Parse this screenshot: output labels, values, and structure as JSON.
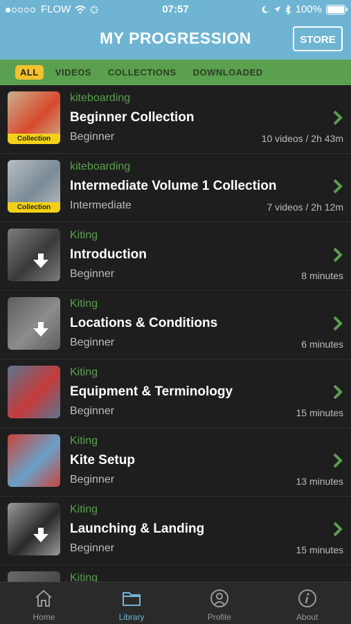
{
  "status_bar": {
    "carrier": "FLOW",
    "time": "07:57",
    "battery": "100%"
  },
  "header": {
    "title": "MY PROGRESSION",
    "store_label": "STORE"
  },
  "filters": [
    {
      "label": "ALL",
      "active": true
    },
    {
      "label": "VIDEOS",
      "active": false
    },
    {
      "label": "COLLECTIONS",
      "active": false
    },
    {
      "label": "DOWNLOADED",
      "active": false
    }
  ],
  "items": [
    {
      "category": "kiteboarding",
      "title": "Beginner Collection",
      "level": "Beginner",
      "meta": "10 videos / 2h 43m",
      "badge": "Collection",
      "thumb_color": "#c9b08c",
      "accent": "#d84a2f",
      "download": false
    },
    {
      "category": "kiteboarding",
      "title": "Intermediate Volume 1 Collection",
      "level": "Intermediate",
      "meta": "7 videos / 2h 12m",
      "badge": "Collection",
      "thumb_color": "#b9bec2",
      "accent": "#7a8a96",
      "download": false
    },
    {
      "category": "Kiting",
      "title": "Introduction",
      "level": "Beginner",
      "meta": "8 minutes",
      "badge": "",
      "thumb_color": "#7c7c7c",
      "accent": "#3a3a3a",
      "download": true
    },
    {
      "category": "Kiting",
      "title": "Locations & Conditions",
      "level": "Beginner",
      "meta": "6 minutes",
      "badge": "",
      "thumb_color": "#5e5e5e",
      "accent": "#8c8c8c",
      "download": true
    },
    {
      "category": "Kiting",
      "title": "Equipment & Terminology",
      "level": "Beginner",
      "meta": "15 minutes",
      "badge": "",
      "thumb_color": "#5c7490",
      "accent": "#c43b3b",
      "download": false
    },
    {
      "category": "Kiting",
      "title": "Kite Setup",
      "level": "Beginner",
      "meta": "13 minutes",
      "badge": "",
      "thumb_color": "#c9453a",
      "accent": "#6aa0c8",
      "download": false
    },
    {
      "category": "Kiting",
      "title": "Launching & Landing",
      "level": "Beginner",
      "meta": "15 minutes",
      "badge": "",
      "thumb_color": "#9a9a9a",
      "accent": "#2a2a2a",
      "download": true
    },
    {
      "category": "Kiting",
      "title": "",
      "level": "",
      "meta": "",
      "badge": "",
      "thumb_color": "#6a6a6a",
      "accent": "#4a4a4a",
      "download": false
    }
  ],
  "tabs": [
    {
      "label": "Home",
      "icon": "home-icon",
      "active": false
    },
    {
      "label": "Library",
      "icon": "folder-icon",
      "active": true
    },
    {
      "label": "Profile",
      "icon": "profile-icon",
      "active": false
    },
    {
      "label": "About",
      "icon": "info-icon",
      "active": false
    }
  ],
  "colors": {
    "header_bg": "#6fb5d3",
    "filter_bg": "#5aa04e",
    "active_filter": "#f6c02e",
    "category_text": "#5aa04e",
    "badge": "#f3d118"
  }
}
